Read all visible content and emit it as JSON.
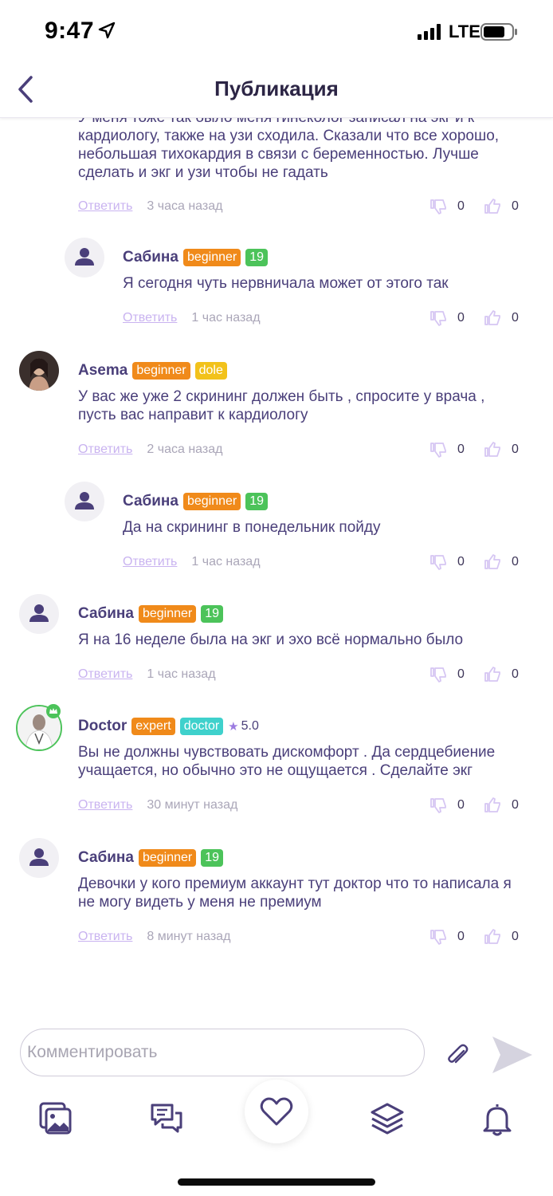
{
  "status_bar": {
    "time": "9:47",
    "network": "LTE"
  },
  "header": {
    "title": "Публикация"
  },
  "feed": {
    "top_comment": {
      "text": "У меня тоже так было меня гинеколог записал на экг и к кардиологу, также на узи сходила. Сказали что все хорошо, небольшая тихокардия в связи с беременностью. Лучше сделать и экг и узи чтобы не гадать",
      "reply_label": "Ответить",
      "time": "3 часа назад",
      "dislikes": "0",
      "likes": "0"
    },
    "comments": [
      {
        "author": "Сабина",
        "badges": [
          "beginner",
          "19"
        ],
        "text": "Я сегодня чуть нервничала может от этого так",
        "reply_label": "Ответить",
        "time": "1 час назад",
        "dislikes": "0",
        "likes": "0"
      },
      {
        "author": "Asema",
        "badges": [
          "beginner",
          "dole"
        ],
        "text": "У вас же уже 2 скрининг должен быть , спросите у врача , пусть вас направит к кардиологу",
        "reply_label": "Ответить",
        "time": "2 часа назад",
        "dislikes": "0",
        "likes": "0"
      },
      {
        "author": "Сабина",
        "badges": [
          "beginner",
          "19"
        ],
        "text": "Да на скрининг в понедельник пойду",
        "reply_label": "Ответить",
        "time": "1 час назад",
        "dislikes": "0",
        "likes": "0"
      },
      {
        "author": "Сабина",
        "badges": [
          "beginner",
          "19"
        ],
        "text": "Я на 16 неделе была на экг и эхо всё нормально было",
        "reply_label": "Ответить",
        "time": "1 час назад",
        "dislikes": "0",
        "likes": "0"
      },
      {
        "author": "Doctor",
        "badges": [
          "expert",
          "doctor"
        ],
        "rating": "5.0",
        "text": "Вы не должны чувствовать дискомфорт . Да сердцебиение учащается, но обычно это не ощущается . Сделайте экг",
        "reply_label": "Ответить",
        "time": "30 минут назад",
        "dislikes": "0",
        "likes": "0"
      },
      {
        "author": "Сабина",
        "badges": [
          "beginner",
          "19"
        ],
        "text": "Девочки у кого премиум аккаунт тут доктор что то написала я не могу видеть у меня не премиум",
        "reply_label": "Ответить",
        "time": "8 минут назад",
        "dislikes": "0",
        "likes": "0"
      }
    ]
  },
  "composer": {
    "placeholder": "Комментировать"
  },
  "tabbar": {
    "icons": [
      "gallery-icon",
      "chat-icon",
      "heart-icon",
      "layers-icon",
      "bell-icon"
    ]
  },
  "colors": {
    "primary": "#4a3f7a",
    "badge_orange": "#f08a1a",
    "badge_green": "#4cc35a",
    "badge_yellow": "#f2c21b",
    "badge_teal": "#3fd1cc",
    "reply_link": "#c9b3f0"
  }
}
